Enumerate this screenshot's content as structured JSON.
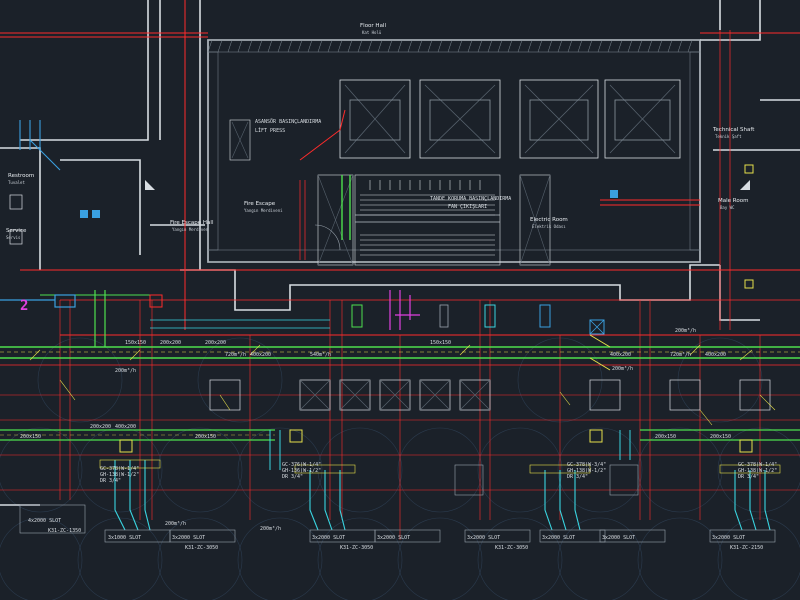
{
  "rooms": {
    "floor_hall": {
      "line1": "Floor Hall",
      "line2": "Kat Holü"
    },
    "fire_escape_hall": {
      "line1": "Fire Escape Hall",
      "line2": "Yangın Merdiven"
    },
    "fire_escape": {
      "line1": "Fire Escape",
      "line2": "Yangın Merdiveni"
    },
    "electric_room": {
      "line1": "Electric Room",
      "line2": "Elektrik Odası"
    },
    "technical_shaft": {
      "line1": "Technical Shaft",
      "line2": "Teknik Şaft"
    },
    "male_room": {
      "line1": "Male Room",
      "line2": "Bay WC"
    },
    "restroom_left": {
      "line1": "Restroom",
      "line2": "Tuvalet"
    },
    "service_left": {
      "line1": "Service",
      "line2": "Servis"
    }
  },
  "slots": [
    {
      "text": "4x2000 SLOT"
    },
    {
      "text": "3x1000 SLOT"
    },
    {
      "text": "3x2000 SLOT"
    },
    {
      "text": "3x2000 SLOT"
    },
    {
      "text": "3x2000 SLOT"
    },
    {
      "text": "3x2000 SLOT"
    },
    {
      "text": "3x2000 SLOT"
    },
    {
      "text": "3x2000 SLOT"
    },
    {
      "text": "3x2000 SLOT"
    }
  ],
  "zones": [
    {
      "text": "K31-ZC-1350"
    },
    {
      "text": "K31-ZC-3050"
    },
    {
      "text": "K31-ZC-3050"
    },
    {
      "text": "K31-ZC-3050"
    },
    {
      "text": "K31-ZC-2150"
    }
  ],
  "duct_sizes": {
    "main_a": "150x150",
    "main_b": "200x200",
    "main_c": "400x200",
    "main_d": "720m³/h",
    "main_e": "540m³/h",
    "main_f": "150x150",
    "main_g": "400x200",
    "main_h": "720m³/h",
    "main_i": "200x200",
    "main_j": "400x200",
    "low_a": "200x200",
    "low_b": "400x200",
    "low_c": "200x150",
    "low_d": "200x150",
    "low_e": "200x150",
    "low_f": "200x150"
  },
  "units": [
    {
      "code": "GC-378(W-1/4\"",
      "sub": "GH-138(W-1/2\"",
      "dr": "DR 3/4\""
    },
    {
      "code": "GC-376(W-1/4\"",
      "sub": "GH-136(W-1/2\"",
      "dr": "DR 3/4\""
    },
    {
      "code": "GC-378(W-3/4\"",
      "sub": "GH-138(W-1/2\"",
      "dr": "DR 3/4\""
    },
    {
      "code": "GC-378(W-1/4\"",
      "sub": "GH-138(W-1/2\"",
      "dr": "DR 3/4\""
    }
  ],
  "airflow": {
    "a": "200m³/h",
    "b": "200m³/h",
    "c": "200m³/h",
    "d": "200m³/h",
    "e": "200m³/h"
  },
  "stair_note": "TANDE KORUMA BASINÇLANDIRMA",
  "stair_note2": "FAN ÇIKIŞLARI",
  "lift_note": "ASANSÖR BASINÇLANDIRMA",
  "lift_note2": "LİFT PRESS",
  "marker_two": "2",
  "colors": {
    "background": "#1b2129",
    "wall": "#d8dde2",
    "red": "#ff2b2b",
    "green_duct": "#4ee04e",
    "cyan": "#39d4e0",
    "yellow": "#e6e04a",
    "magenta": "#e040e0",
    "grid": "#2c3a48"
  }
}
